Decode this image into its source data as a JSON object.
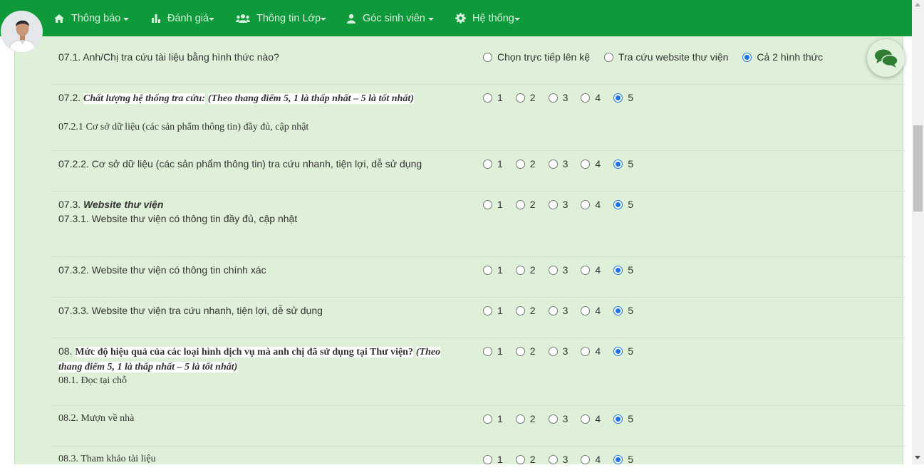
{
  "nav": {
    "items": [
      {
        "label": "Thông báo",
        "icon": "home-icon"
      },
      {
        "label": "Đánh giá",
        "icon": "bar-chart-icon"
      },
      {
        "label": "Thông tin Lớp",
        "icon": "users-icon"
      },
      {
        "label": "Góc sinh viên",
        "icon": "user-icon"
      },
      {
        "label": "Hệ thống",
        "icon": "gear-icon"
      }
    ]
  },
  "colors": {
    "navbar": "#0e9a3a",
    "panel": "#dff0d8",
    "radio_selected": "#1a73e8"
  },
  "scale": [
    "1",
    "2",
    "3",
    "4",
    "5"
  ],
  "q071": {
    "text": "07.1. Anh/Chị tra cứu tài liệu bằng hình thức nào?",
    "options": [
      "Chọn trực tiếp lên kệ",
      "Tra cứu website thư viện",
      "Cả 2 hình thức"
    ],
    "selected": "Cả 2 hình thức"
  },
  "q072": {
    "prefix": "07.2. ",
    "title": "Chất lượng hệ thống tra cứu:",
    "note": "(Theo thang điểm 5, 1 là thấp nhất – 5 là tốt nhất)",
    "sub": "07.2.1 Cơ sở dữ liệu (các sản phẩm thông tin) đầy đủ, cập nhật",
    "selected": "5"
  },
  "q0722": {
    "text": "07.2.2. Cơ sở dữ liệu (các sản phẩm thông tin) tra cứu nhanh, tiện lợi, dễ sử dụng",
    "selected": "5"
  },
  "q073": {
    "prefix": "07.3. ",
    "title": "Website thư viện",
    "sub": "07.3.1. Website thư viện có thông tin đầy đủ, cập nhật",
    "selected": "5"
  },
  "q0732": {
    "text": "07.3.2. Website thư viện có thông tin chính xác",
    "selected": "5"
  },
  "q0733": {
    "text": "07.3.3. Website thư viện tra cứu nhanh, tiện lợi, dễ sử dụng",
    "selected": "5"
  },
  "q08": {
    "prefix": "08. ",
    "title": "Mức độ hiệu quả của các loại hình dịch vụ mà anh chị đã sử dụng tại Thư viện?",
    "note_line1": "(Theo",
    "note_line2": "thang điểm 5, 1 là thấp nhất – 5 là tốt nhất)",
    "sub": "08.1. Đọc tại chỗ",
    "selected": "5"
  },
  "q082": {
    "text": "08.2. Mượn về nhà",
    "selected": "5"
  },
  "q083": {
    "text": "08.3. Tham khảo tài liệu",
    "selected": "5"
  },
  "chat": {
    "icon": "chat-bubbles-icon"
  },
  "avatar": {
    "icon": "user-avatar"
  }
}
